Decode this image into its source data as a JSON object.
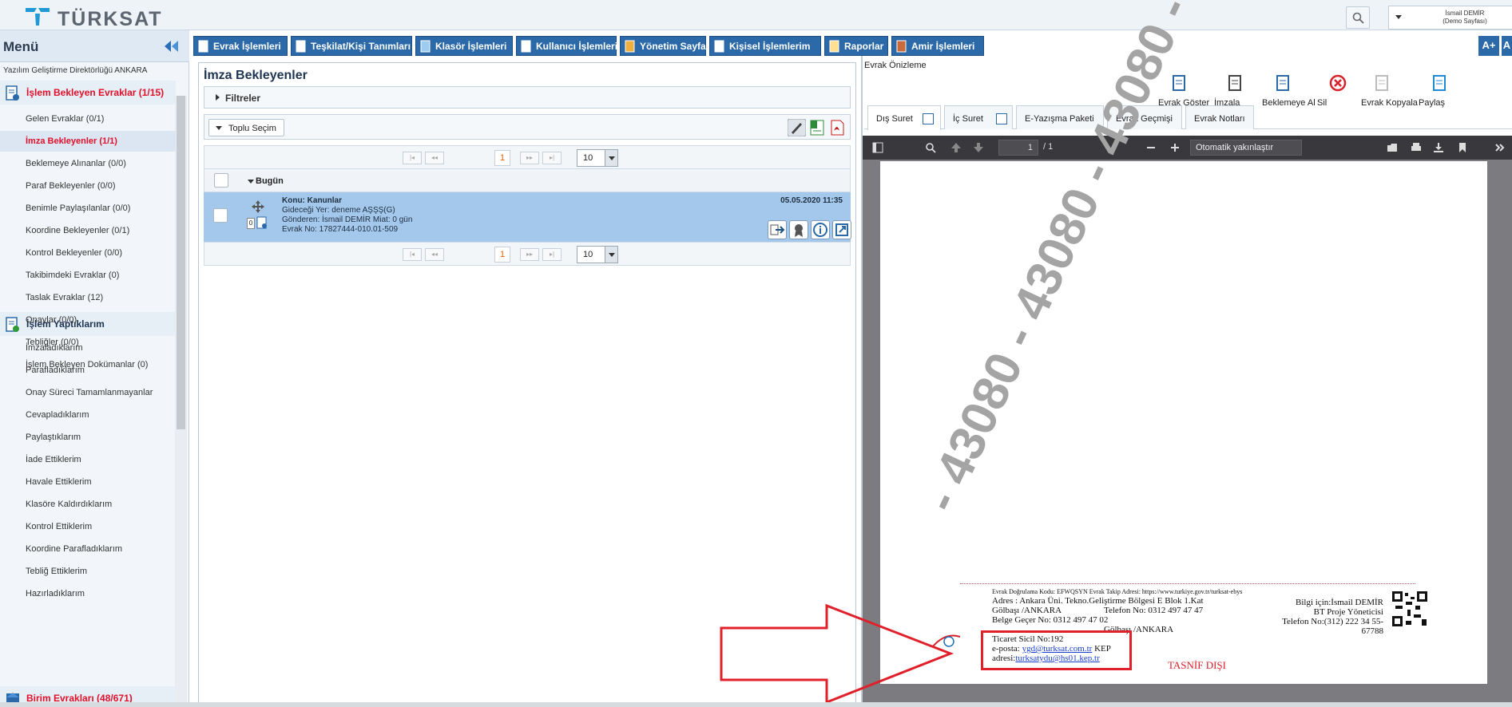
{
  "header": {
    "logo_text": "TÜRKSAT",
    "user_name": "İsmail DEMİR",
    "user_sub": "(Demo Sayfası)"
  },
  "sidebar": {
    "title": "Menü",
    "department": "Yazılım Geliştirme Direktörlüğü ANKARA",
    "sec1": "İşlem Bekleyen Evraklar (1/15)",
    "sec1_items": [
      "Gelen Evraklar (0/1)",
      "İmza Bekleyenler (1/1)",
      "Beklemeye Alınanlar (0/0)",
      "Paraf Bekleyenler (0/0)",
      "Benimle Paylaşılanlar (0/0)",
      "Koordine Bekleyenler (0/1)",
      "Kontrol Bekleyenler (0/0)",
      "Takibimdeki Evraklar (0)",
      "Taslak Evraklar (12)",
      "Onaylar (0/0)",
      "Tebliğler (0/0)",
      "İşlem Bekleyen Dokümanlar (0)"
    ],
    "sec2": "İşlem Yaptıklarım",
    "sec2_items": [
      "İmzaladıklarım",
      "Parafladıklarım",
      "Onay Süreci Tamamlanmayanlar",
      "Cevapladıklarım",
      "Paylaştıklarım",
      "İade Ettiklerim",
      "Havale Ettiklerim",
      "Klasöre Kaldırdıklarım",
      "Kontrol Ettiklerim",
      "Koordine Parafladıklarım",
      "Tebliğ Ettiklerim",
      "Hazırladıklarım"
    ],
    "sec3": "Birim Evrakları (48/671)"
  },
  "nav": [
    "Evrak İşlemleri",
    "Teşkilat/Kişi Tanımları",
    "Klasör İşlemleri",
    "Kullanıcı İşlemleri",
    "Yönetim Sayfaları",
    "Kişisel İşlemlerim",
    "Raporlar",
    "Amir İşlemleri"
  ],
  "font_buttons": [
    "A+",
    "A"
  ],
  "middle": {
    "title": "İmza Bekleyenler",
    "filters": "Filtreler",
    "bulk": "Toplu Seçim",
    "page": "1",
    "page_size": "10",
    "pager_first": "|◂",
    "pager_prev": "◂◂",
    "pager_next": "▸▸",
    "pager_last": "▸|",
    "group": "Bugün",
    "row": {
      "subject": "Konu: Kanunlar",
      "dest": "Gideceği Yer: deneme AŞŞŞ(G)",
      "sender": "Gönderen: İsmail DEMİR Miat: 0 gün",
      "no": "Evrak No: 17827444-010.01-509",
      "date": "05.05.2020 11:35",
      "count": "0"
    }
  },
  "right": {
    "title": "Evrak Önizleme",
    "tools": [
      "Evrak Göster",
      "İmzala",
      "Beklemeye Al",
      "Sil",
      "Evrak Kopyala",
      "Paylaş"
    ],
    "tabs": [
      "Dış Suret",
      "İç Suret",
      "E-Yazışma Paketi",
      "Evrak Geçmişi",
      "Evrak Notları"
    ],
    "pdf": {
      "page": "1",
      "total": "/ 1",
      "zoom": "Otomatik yakınlaştır"
    },
    "doc": {
      "watermark": "- 43080 - 43080 - 43080 - 43080",
      "verify": "Evrak Doğrulama Kodu: EFWQSYN Evrak Takip Adresi: https://www.turkiye.gov.tr/turksat-ebys",
      "addr1": "Adres    : Ankara Üni. Tekno.Geliştirme Bölgesi E Blok 1.Kat",
      "addr2": "Gölbaşı /ANKARA",
      "tel": "Telefon No: 0312 497 47 47",
      "fax": "Belge Geçer No: 0312 497 47 02",
      "addr3": "Gölbaşı /ANKARA",
      "sicil": "Ticaret Sicil No:192",
      "email_lbl": "e-posta:",
      "email": "ygd@turksat.com.tr",
      "kep_lbl": "KEP",
      "kep_addr_lbl": "adresi:",
      "kep": "turksatydu@hs01.kep.tr",
      "info1": "Bilgi için:İsmail DEMİR",
      "info2": "BT Proje Yöneticisi",
      "info3": "Telefon No:(312) 222 34 55-",
      "info4": "67788",
      "tasnif": "TASNİF DIŞI"
    }
  },
  "colors": {
    "accent": "#2b69a8",
    "highlight": "#e0102a",
    "row": "#a4c8ec",
    "annotation": "#e0202a"
  }
}
